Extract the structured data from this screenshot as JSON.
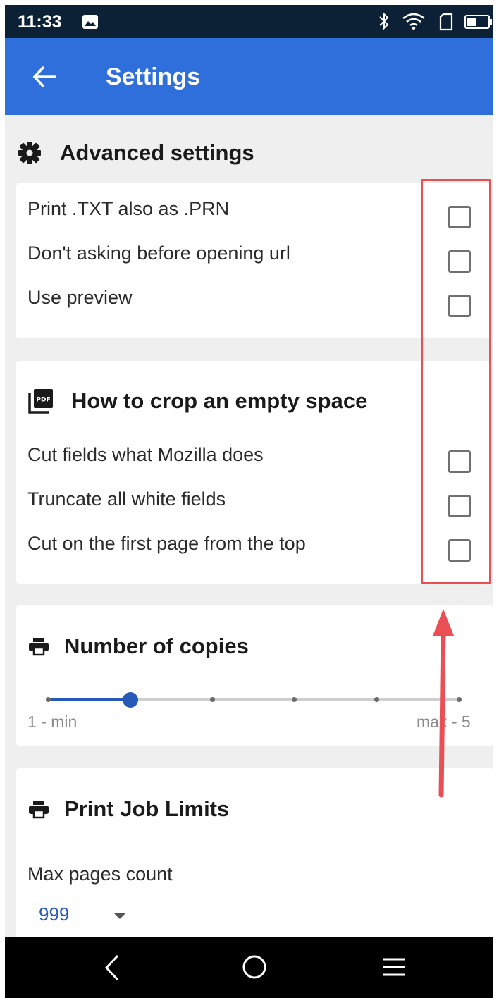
{
  "status_bar": {
    "time": "11:33",
    "icons": [
      "image-icon",
      "bluetooth-icon",
      "wifi-icon",
      "sim-icon",
      "battery-icon"
    ]
  },
  "app_bar": {
    "title": "Settings",
    "back_icon": "arrow-left-icon",
    "color": "#2f6fdc"
  },
  "advanced": {
    "title": "Advanced settings",
    "icon": "gear-icon",
    "items": [
      {
        "label": "Print .TXT also as .PRN",
        "checked": false
      },
      {
        "label": "Don't asking before opening url",
        "checked": false
      },
      {
        "label": "Use preview",
        "checked": false
      }
    ]
  },
  "crop": {
    "title": "How to crop an empty space",
    "icon": "pdf-icon",
    "items": [
      {
        "label": "Cut fields what Mozilla does",
        "checked": false
      },
      {
        "label": "Truncate all white fields",
        "checked": false
      },
      {
        "label": "Cut on the first page from the top",
        "checked": false
      }
    ]
  },
  "copies": {
    "title": "Number of copies",
    "icon": "printer-icon",
    "min_label": "1 - min",
    "max_label": "max - 5",
    "min": 0,
    "max": 5,
    "value": 1,
    "accent": "#2659b8"
  },
  "job_limits": {
    "title": "Print Job Limits",
    "icon": "printer-icon",
    "field_label": "Max pages count",
    "field_value": "999"
  },
  "nav_bar": {
    "icons": [
      "nav-back-icon",
      "nav-home-icon",
      "nav-menu-icon"
    ]
  },
  "annotation": {
    "color": "#e94f55"
  }
}
